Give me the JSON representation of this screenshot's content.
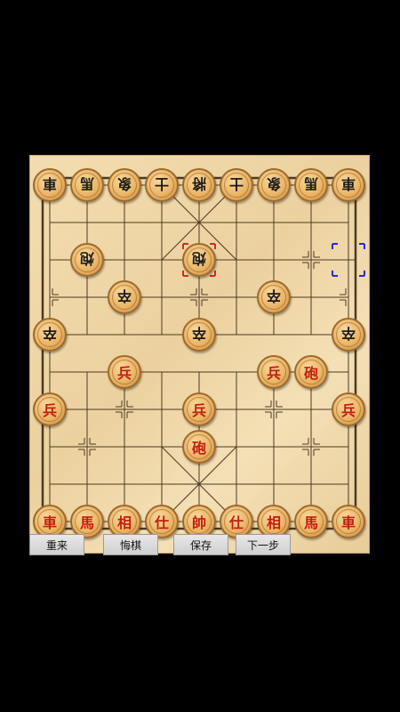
{
  "board": {
    "cols": 9,
    "rows": 10,
    "last_move_from": [
      8,
      2
    ],
    "last_move_to": [
      4,
      2
    ]
  },
  "pieces": [
    {
      "char": "車",
      "side": "black",
      "col": 0,
      "row": 0
    },
    {
      "char": "馬",
      "side": "black",
      "col": 1,
      "row": 0
    },
    {
      "char": "象",
      "side": "black",
      "col": 2,
      "row": 0
    },
    {
      "char": "士",
      "side": "black",
      "col": 3,
      "row": 0
    },
    {
      "char": "將",
      "side": "black",
      "col": 4,
      "row": 0
    },
    {
      "char": "士",
      "side": "black",
      "col": 5,
      "row": 0
    },
    {
      "char": "象",
      "side": "black",
      "col": 6,
      "row": 0
    },
    {
      "char": "馬",
      "side": "black",
      "col": 7,
      "row": 0
    },
    {
      "char": "車",
      "side": "black",
      "col": 8,
      "row": 0
    },
    {
      "char": "炮",
      "side": "black",
      "col": 1,
      "row": 2
    },
    {
      "char": "炮",
      "side": "black",
      "col": 4,
      "row": 2
    },
    {
      "char": "卒",
      "side": "black",
      "col": 2,
      "row": 3
    },
    {
      "char": "卒",
      "side": "black",
      "col": 6,
      "row": 3
    },
    {
      "char": "卒",
      "side": "black",
      "col": 0,
      "row": 4
    },
    {
      "char": "卒",
      "side": "black",
      "col": 4,
      "row": 4
    },
    {
      "char": "卒",
      "side": "black",
      "col": 8,
      "row": 4
    },
    {
      "char": "兵",
      "side": "red",
      "col": 2,
      "row": 5
    },
    {
      "char": "兵",
      "side": "red",
      "col": 6,
      "row": 5
    },
    {
      "char": "砲",
      "side": "red",
      "col": 7,
      "row": 5
    },
    {
      "char": "兵",
      "side": "red",
      "col": 0,
      "row": 6
    },
    {
      "char": "兵",
      "side": "red",
      "col": 4,
      "row": 6
    },
    {
      "char": "兵",
      "side": "red",
      "col": 8,
      "row": 6
    },
    {
      "char": "砲",
      "side": "red",
      "col": 4,
      "row": 7
    },
    {
      "char": "車",
      "side": "red",
      "col": 0,
      "row": 9
    },
    {
      "char": "馬",
      "side": "red",
      "col": 1,
      "row": 9
    },
    {
      "char": "相",
      "side": "red",
      "col": 2,
      "row": 9
    },
    {
      "char": "仕",
      "side": "red",
      "col": 3,
      "row": 9
    },
    {
      "char": "帥",
      "side": "red",
      "col": 4,
      "row": 9
    },
    {
      "char": "仕",
      "side": "red",
      "col": 5,
      "row": 9
    },
    {
      "char": "相",
      "side": "red",
      "col": 6,
      "row": 9
    },
    {
      "char": "馬",
      "side": "red",
      "col": 7,
      "row": 9
    },
    {
      "char": "車",
      "side": "red",
      "col": 8,
      "row": 9
    }
  ],
  "toolbar": {
    "restart_label": "重来",
    "undo_label": "悔棋",
    "save_label": "保存",
    "next_label": "下一步"
  },
  "colors": {
    "board_line": "#4a3a22",
    "red_piece_text": "#c41e0e",
    "black_piece_text": "#1b1b1b",
    "last_move_from_marker": "#1e2bd6",
    "last_move_to_marker": "#d42a1a"
  }
}
